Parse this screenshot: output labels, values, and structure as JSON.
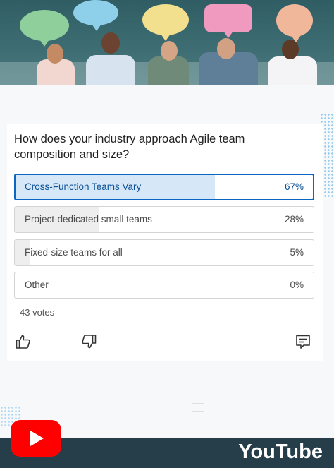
{
  "poll": {
    "question": "How does your industry approach Agile team composition and size?",
    "options": [
      {
        "label": "Cross-Function Teams Vary",
        "percent": "67%",
        "value": 67,
        "selected": true
      },
      {
        "label": "Project-dedicated small teams",
        "percent": "28%",
        "value": 28,
        "selected": false
      },
      {
        "label": "Fixed-size teams for all",
        "percent": "5%",
        "value": 5,
        "selected": false
      },
      {
        "label": "Other",
        "percent": "0%",
        "value": 0,
        "selected": false
      }
    ],
    "votes": "43 votes"
  },
  "actions": {
    "like_icon": "thumbs-up-icon",
    "dislike_icon": "thumbs-down-icon",
    "comment_icon": "comment-icon"
  },
  "branding": {
    "youtube_word": "YouTube",
    "accent": "#0a66c2",
    "youtube_red": "#ff0000"
  }
}
